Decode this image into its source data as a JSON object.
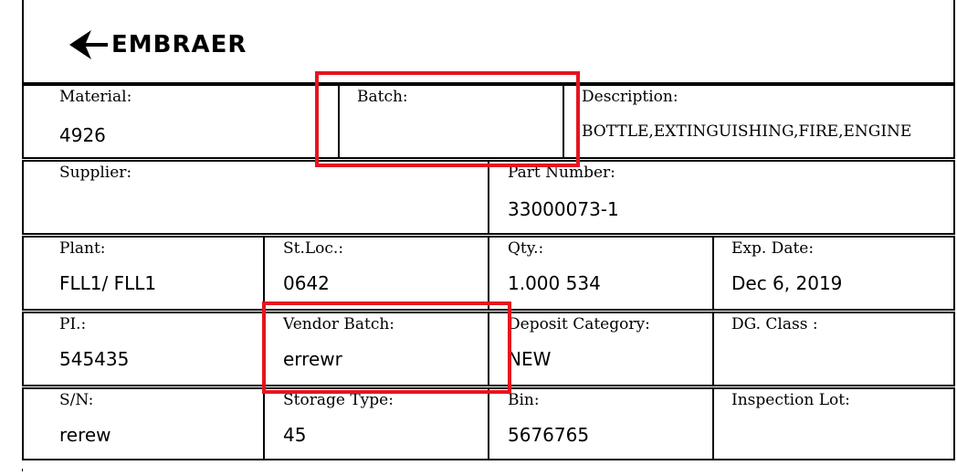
{
  "logo": {
    "brand": "EMBRAER"
  },
  "row1": {
    "material": {
      "label": "Material:",
      "value": "4926"
    },
    "batch": {
      "label": "Batch:",
      "value": ""
    },
    "description": {
      "label": "Description:",
      "value": "BOTTLE,EXTINGUISHING,FIRE,ENGINE"
    }
  },
  "row2": {
    "supplier": {
      "label": "Supplier:",
      "value": ""
    },
    "part_number": {
      "label": "Part Number:",
      "value": "33000073-1"
    }
  },
  "row3": {
    "plant": {
      "label": "Plant:",
      "value": "FLL1/ FLL1"
    },
    "stloc": {
      "label": "St.Loc.:",
      "value": "0642"
    },
    "qty": {
      "label": "Qty.:",
      "value": "1.000 534"
    },
    "exp_date": {
      "label": "Exp. Date:",
      "value": "Dec 6, 2019"
    }
  },
  "row4": {
    "pi": {
      "label": "PI.:",
      "value": "545435"
    },
    "vendor_batch": {
      "label": "Vendor Batch:",
      "value": "errewr"
    },
    "deposit_category": {
      "label": "Deposit Category:",
      "value": "NEW"
    },
    "dg_class": {
      "label": "DG. Class :",
      "value": ""
    }
  },
  "row5": {
    "sn": {
      "label": "S/N:",
      "value": "rerew"
    },
    "storage_type": {
      "label": "Storage Type:",
      "value": "45"
    },
    "bin": {
      "label": "Bin:",
      "value": "5676765"
    },
    "inspection_lot": {
      "label": "Inspection Lot:",
      "value": ""
    }
  },
  "colors": {
    "highlight": "#e5151f",
    "border": "#000000"
  }
}
